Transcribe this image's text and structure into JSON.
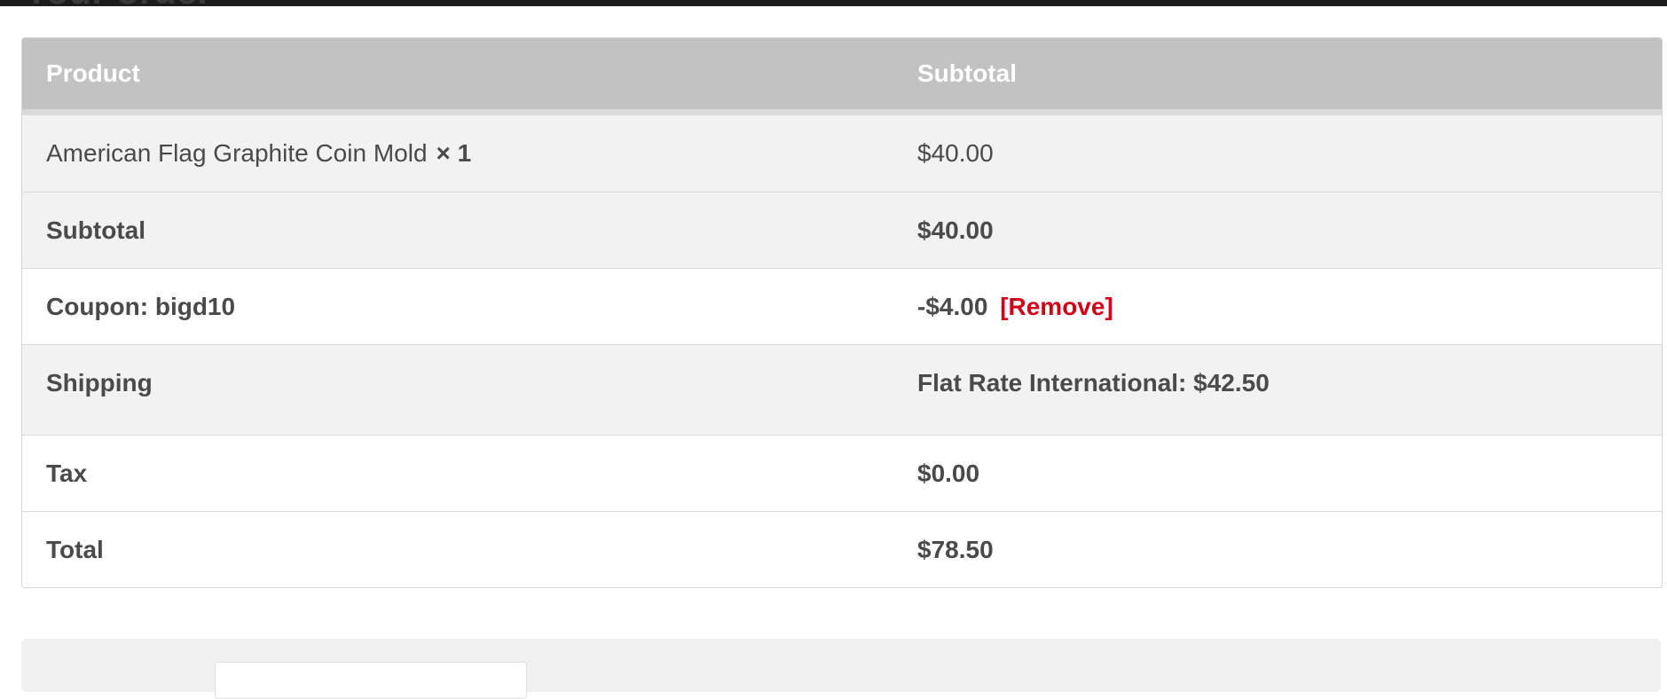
{
  "page": {
    "heading": "Your order"
  },
  "table": {
    "header": {
      "product": "Product",
      "subtotal": "Subtotal"
    },
    "item": {
      "name": "American Flag Graphite Coin Mold",
      "quantity": "× 1",
      "price": "$40.00"
    },
    "subtotal": {
      "label": "Subtotal",
      "value": "$40.00"
    },
    "coupon": {
      "label": "Coupon: bigd10",
      "value": "-$4.00",
      "remove": "[Remove]"
    },
    "shipping": {
      "label": "Shipping",
      "value": "Flat Rate International: $42.50"
    },
    "tax": {
      "label": "Tax",
      "value": "$0.00"
    },
    "total": {
      "label": "Total",
      "value": "$78.50"
    }
  },
  "colors": {
    "header_bg": "#c2c2c2",
    "row_alt_bg": "#f2f2f2",
    "remove_link": "#d0021b"
  }
}
